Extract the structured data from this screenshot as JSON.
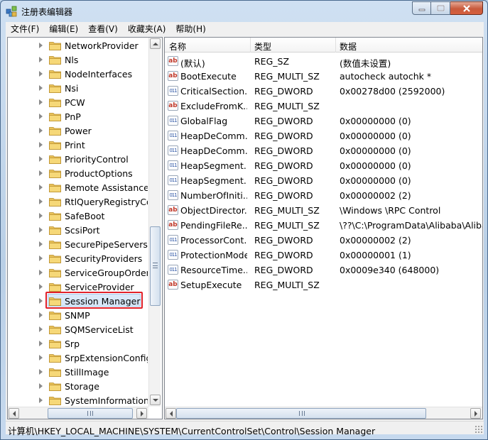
{
  "window": {
    "title": "注册表编辑器",
    "icon": "regedit-icon",
    "close_color": "#c85a3c"
  },
  "menu": [
    "文件(F)",
    "编辑(E)",
    "查看(V)",
    "收藏夹(A)",
    "帮助(H)"
  ],
  "tree": {
    "items": [
      {
        "label": "NetworkProvider"
      },
      {
        "label": "Nls"
      },
      {
        "label": "NodeInterfaces"
      },
      {
        "label": "Nsi"
      },
      {
        "label": "PCW"
      },
      {
        "label": "PnP"
      },
      {
        "label": "Power"
      },
      {
        "label": "Print"
      },
      {
        "label": "PriorityControl"
      },
      {
        "label": "ProductOptions"
      },
      {
        "label": "Remote Assistance"
      },
      {
        "label": "RtlQueryRegistryConfig"
      },
      {
        "label": "SafeBoot"
      },
      {
        "label": "ScsiPort"
      },
      {
        "label": "SecurePipeServers"
      },
      {
        "label": "SecurityProviders"
      },
      {
        "label": "ServiceGroupOrder"
      },
      {
        "label": "ServiceProvider"
      },
      {
        "label": "Session Manager"
      },
      {
        "label": "SNMP"
      },
      {
        "label": "SQMServiceList"
      },
      {
        "label": "Srp"
      },
      {
        "label": "SrpExtensionConfig"
      },
      {
        "label": "StillImage"
      },
      {
        "label": "Storage"
      },
      {
        "label": "SystemInformation"
      }
    ],
    "selected": "Session Manager",
    "highlight_color": "#e0212a"
  },
  "list": {
    "columns": [
      "名称",
      "类型",
      "数据"
    ],
    "rows": [
      {
        "icon": "ab",
        "name": "(默认)",
        "type": "REG_SZ",
        "data": "(数值未设置)"
      },
      {
        "icon": "ab",
        "name": "BootExecute",
        "type": "REG_MULTI_SZ",
        "data": "autocheck autochk *"
      },
      {
        "icon": "bin",
        "name": "CriticalSection...",
        "type": "REG_DWORD",
        "data": "0x00278d00 (2592000)"
      },
      {
        "icon": "ab",
        "name": "ExcludeFromK...",
        "type": "REG_MULTI_SZ",
        "data": ""
      },
      {
        "icon": "bin",
        "name": "GlobalFlag",
        "type": "REG_DWORD",
        "data": "0x00000000 (0)"
      },
      {
        "icon": "bin",
        "name": "HeapDeComm...",
        "type": "REG_DWORD",
        "data": "0x00000000 (0)"
      },
      {
        "icon": "bin",
        "name": "HeapDeComm...",
        "type": "REG_DWORD",
        "data": "0x00000000 (0)"
      },
      {
        "icon": "bin",
        "name": "HeapSegment...",
        "type": "REG_DWORD",
        "data": "0x00000000 (0)"
      },
      {
        "icon": "bin",
        "name": "HeapSegment...",
        "type": "REG_DWORD",
        "data": "0x00000000 (0)"
      },
      {
        "icon": "bin",
        "name": "NumberOfIniti...",
        "type": "REG_DWORD",
        "data": "0x00000002 (2)"
      },
      {
        "icon": "ab",
        "name": "ObjectDirector...",
        "type": "REG_MULTI_SZ",
        "data": "\\Windows \\RPC Control"
      },
      {
        "icon": "ab",
        "name": "PendingFileRe...",
        "type": "REG_MULTI_SZ",
        "data": "\\??\\C:\\ProgramData\\Alibaba\\Alibaba"
      },
      {
        "icon": "bin",
        "name": "ProcessorCont...",
        "type": "REG_DWORD",
        "data": "0x00000002 (2)"
      },
      {
        "icon": "bin",
        "name": "ProtectionMode",
        "type": "REG_DWORD",
        "data": "0x00000001 (1)"
      },
      {
        "icon": "bin",
        "name": "ResourceTime...",
        "type": "REG_DWORD",
        "data": "0x0009e340 (648000)"
      },
      {
        "icon": "ab",
        "name": "SetupExecute",
        "type": "REG_MULTI_SZ",
        "data": ""
      }
    ]
  },
  "status": {
    "path": "计算机\\HKEY_LOCAL_MACHINE\\SYSTEM\\CurrentControlSet\\Control\\Session Manager"
  }
}
